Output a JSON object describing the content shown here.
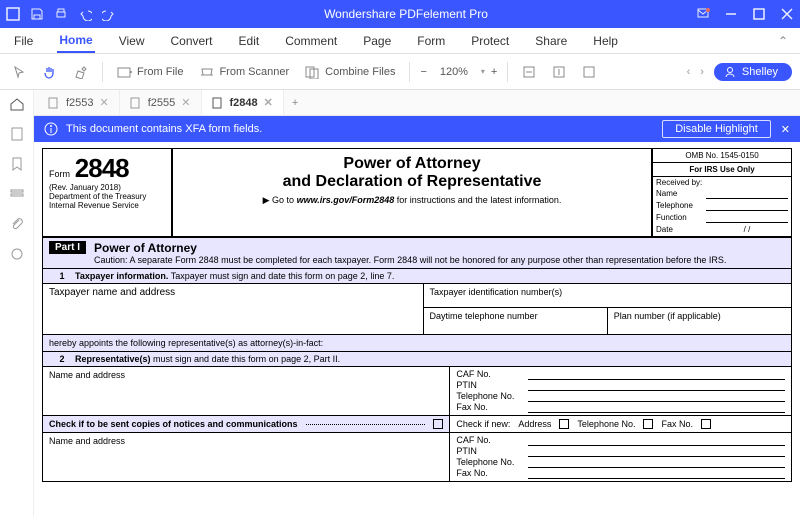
{
  "titlebar": {
    "title": "Wondershare PDFelement Pro"
  },
  "menu": {
    "items": [
      "File",
      "Home",
      "View",
      "Convert",
      "Edit",
      "Comment",
      "Page",
      "Form",
      "Protect",
      "Share",
      "Help"
    ],
    "activeIndex": 1
  },
  "toolbar": {
    "from_file": "From File",
    "from_scanner": "From Scanner",
    "combine": "Combine Files",
    "zoom": "120%",
    "user": "Shelley"
  },
  "tabs": {
    "items": [
      {
        "label": "f2553",
        "active": false
      },
      {
        "label": "f2555",
        "active": false
      },
      {
        "label": "f2848",
        "active": true
      }
    ]
  },
  "infobar": {
    "msg": "This document contains XFA form fields.",
    "disable": "Disable Highlight"
  },
  "form": {
    "form_label": "Form",
    "form_no": "2848",
    "rev": "(Rev. January 2018)",
    "dept": "Department of the Treasury",
    "irs": "Internal Revenue Service",
    "title1": "Power of Attorney",
    "title2": "and Declaration of Representative",
    "goto_prefix": "▶ Go to ",
    "goto_url": "www.irs.gov/Form2848",
    "goto_suffix": " for instructions and the latest information.",
    "omb": "OMB No. 1545-0150",
    "irs_use": "For IRS Use Only",
    "received": "Received by:",
    "name_lbl": "Name",
    "tel_lbl": "Telephone",
    "func_lbl": "Function",
    "date_lbl": "Date",
    "date_slashes": "/        /",
    "part1_badge": "Part I",
    "part1_title": "Power of Attorney",
    "caution": "Caution: A separate Form 2848 must be completed for each taxpayer. Form 2848 will not be honored for any purpose other than representation before the IRS.",
    "sec1_num": "1",
    "sec1": "Taxpayer information. Taxpayer must sign and date this form on page 2, line 7.",
    "tp_name": "Taxpayer name and address",
    "tp_id": "Taxpayer identification number(s)",
    "daytime": "Daytime telephone number",
    "plan": "Plan number (if applicable)",
    "appoint": "hereby appoints the following representative(s) as attorney(s)-in-fact:",
    "sec2_num": "2",
    "sec2": "Representative(s) must sign and date this form on page 2, Part II.",
    "rep_name": "Name and address",
    "caf": "CAF No.",
    "ptin": "PTIN",
    "telno": "Telephone No.",
    "faxno": "Fax No.",
    "check_sent": "Check if to be sent copies of notices and communications",
    "check_new": "Check if new:",
    "addr": "Address",
    "tel2": "Telephone No.",
    "fax2": "Fax No."
  }
}
